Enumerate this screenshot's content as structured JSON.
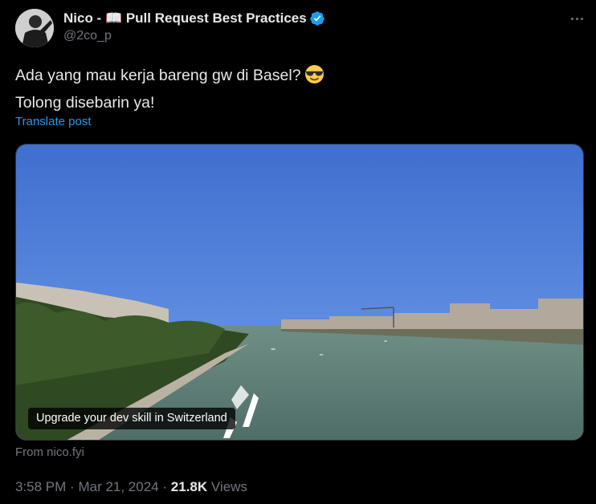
{
  "tweet": {
    "author": {
      "display_name": "Nico - 📖 Pull Request Best Practices",
      "handle": "@2co_p",
      "verified_icon": "verified-badge-icon",
      "avatar_icon": "avatar"
    },
    "text_line1": "Ada yang mau kerja bareng gw di Basel?",
    "text_line1_emoji": "smiling-face-with-sunglasses",
    "text_line2": "Tolong disebarin ya!",
    "translate_label": "Translate post",
    "media": {
      "caption": "Upgrade your dev skill in Switzerland",
      "source": "From nico.fyi"
    },
    "time": "3:58 PM",
    "date": "Mar 21, 2024",
    "separator": "·",
    "views_count": "21.8K",
    "views_label": "Views",
    "colors": {
      "background": "#000000",
      "text": "#e7e9ea",
      "secondary": "#71767b",
      "link": "#1d9bf0",
      "verified": "#1d9bf0"
    }
  }
}
